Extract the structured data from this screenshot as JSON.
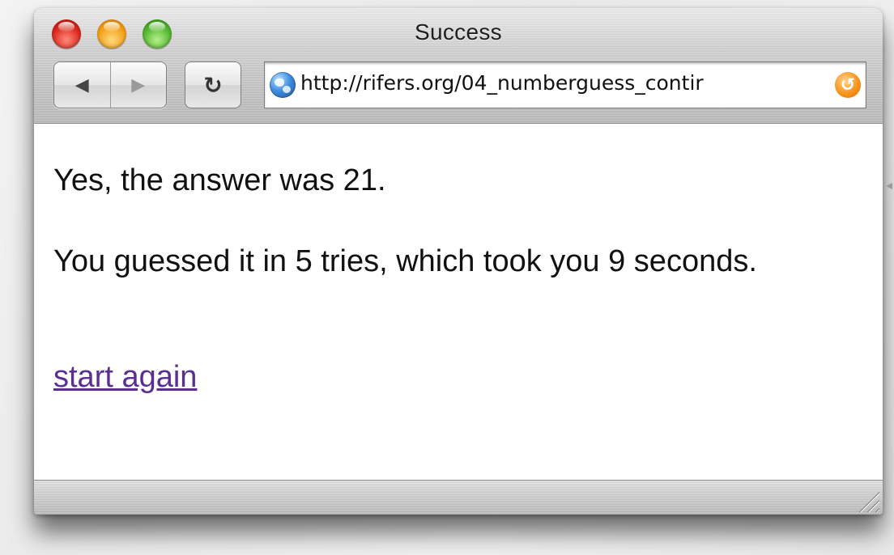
{
  "window": {
    "title": "Success"
  },
  "toolbar": {
    "back_icon": "◀",
    "forward_icon": "▶",
    "reload_icon": "↻",
    "url": "http://rifers.org/04_numberguess_contir",
    "snapback_icon": "↺"
  },
  "page": {
    "line1": "Yes, the answer was 21.",
    "line2": "You guessed it in 5 tries, which took you 9 seconds.",
    "link_text": "start again"
  }
}
